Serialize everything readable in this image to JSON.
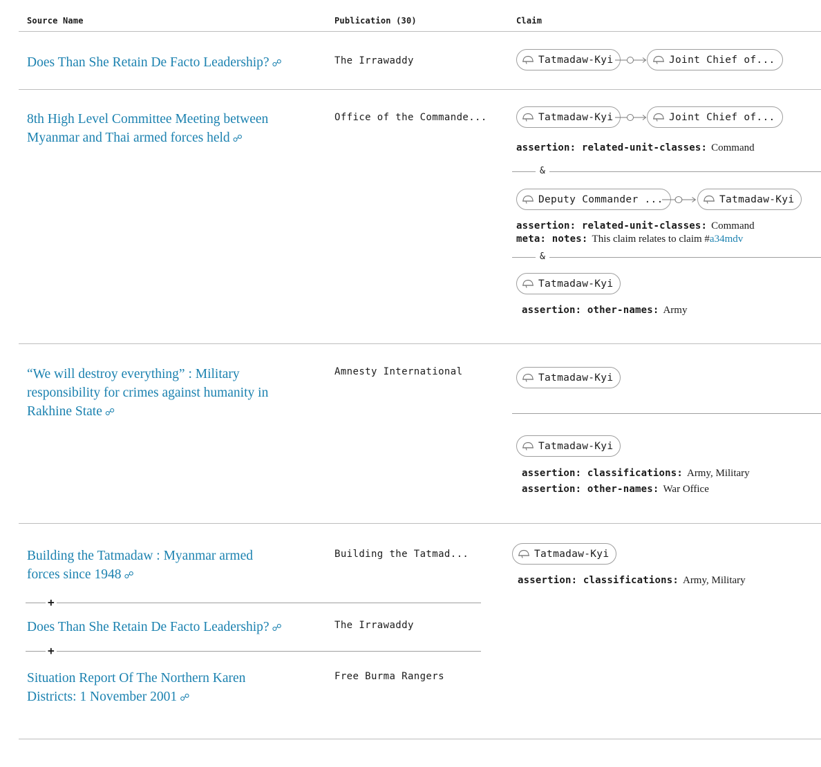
{
  "header": {
    "source_name": "Source Name",
    "publication": "Publication (30)",
    "claim": "Claim"
  },
  "rows": [
    {
      "title": "Does Than She Retain De Facto Leadership?",
      "publication": "The Irrawaddy",
      "chips": [
        "Tatmadaw-Kyi",
        "Joint Chief of..."
      ]
    },
    {
      "title_line1": "8th High Level Committee Meeting between",
      "title_line2": "Myanmar and Thai armed forces held",
      "publication": "Office of the Commande...",
      "claim1": {
        "chips": [
          "Tatmadaw-Kyi",
          "Joint Chief of..."
        ],
        "assertion_key": "assertion: related-unit-classes:",
        "assertion_val": "Command"
      },
      "amp": "&",
      "claim2": {
        "chips": [
          "Deputy Commander ...",
          "Tatmadaw-Kyi"
        ],
        "assertion_key": "assertion: related-unit-classes:",
        "assertion_val": "Command",
        "meta_key": "meta: notes:",
        "meta_val": "This claim relates to claim #",
        "meta_ref": "a34mdv"
      },
      "claim3": {
        "chip": "Tatmadaw-Kyi",
        "assertion_key": "assertion: other-names:",
        "assertion_val": "Army"
      }
    },
    {
      "title_line1": "“We will destroy everything” : Military",
      "title_line2": "responsibility for crimes against humanity in",
      "title_line3": "Rakhine State",
      "publication": "Amnesty International",
      "claim1": {
        "chip": "Tatmadaw-Kyi"
      },
      "claim2": {
        "chip": "Tatmadaw-Kyi",
        "a1_key": "assertion: classifications:",
        "a1_val": "Army, Military",
        "a2_key": "assertion: other-names:",
        "a2_val": "War Office"
      }
    },
    {
      "sources": [
        {
          "title_line1": "Building the Tatmadaw : Myanmar armed",
          "title_line2": "forces since 1948",
          "publication": "Building the Tatmad..."
        },
        {
          "title": "Does Than She Retain De Facto Leadership?",
          "publication": "The Irrawaddy"
        },
        {
          "title_line1": "Situation Report Of The Northern Karen",
          "title_line2": "Districts: 1 November 2001",
          "publication": "Free Burma Rangers"
        }
      ],
      "plus": "+",
      "claim": {
        "chip": "Tatmadaw-Kyi",
        "assertion_key": "assertion: classifications:",
        "assertion_val": "Army, Military"
      }
    }
  ],
  "link_icon": "link-icon",
  "chip_icon": "helmet-icon",
  "colors": {
    "link": "#1c82b0",
    "rule": "#bdbdbd",
    "chip_border": "#9e9e9e"
  }
}
